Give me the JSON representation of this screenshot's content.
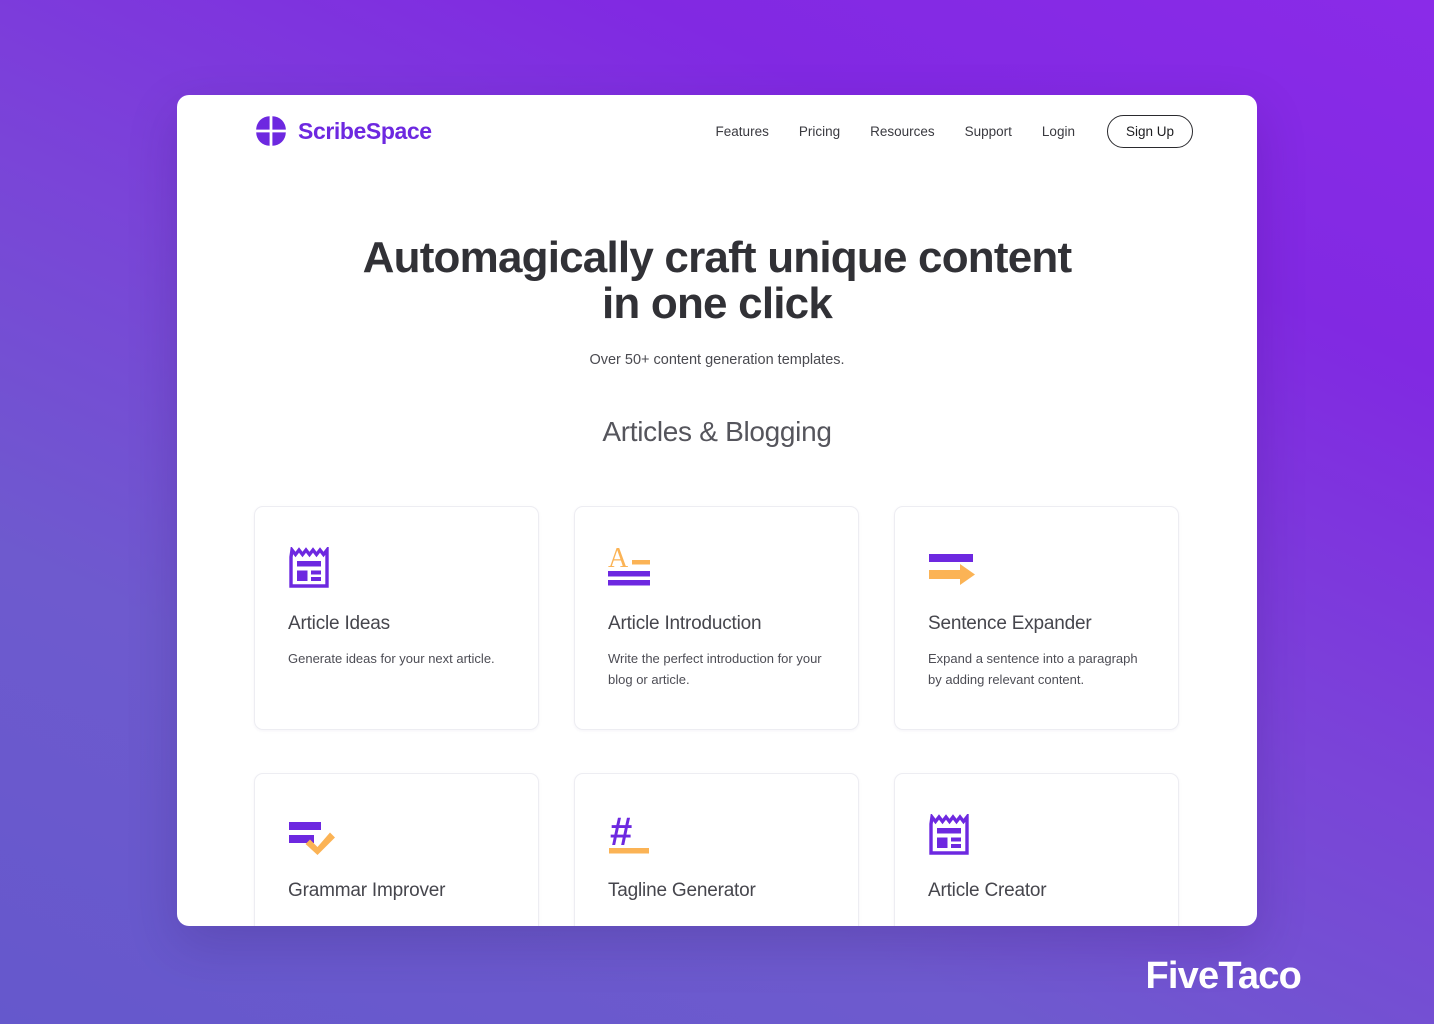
{
  "colors": {
    "brand_purple": "#6d28e0",
    "icon_purple": "#6d28e0",
    "icon_orange": "#fbb355",
    "bg_gradient_from": "#8a2be8",
    "bg_gradient_to": "#6558cc",
    "card_border": "#ededf2"
  },
  "header": {
    "logo_icon": "scribespace-logo-icon",
    "brand_name": "ScribeSpace",
    "nav": [
      {
        "label": "Features"
      },
      {
        "label": "Pricing"
      },
      {
        "label": "Resources"
      },
      {
        "label": "Support"
      },
      {
        "label": "Login"
      }
    ],
    "signup_label": "Sign Up"
  },
  "hero": {
    "title_line1": "Automagically craft unique content",
    "title_line2": "in one click",
    "subtitle": "Over 50+ content generation templates."
  },
  "section": {
    "title": "Articles & Blogging"
  },
  "templates": [
    {
      "icon": "article-layout-icon",
      "title": "Article Ideas",
      "desc": "Generate ideas for your next article."
    },
    {
      "icon": "letter-a-lines-icon",
      "title": "Article Introduction",
      "desc": "Write the perfect introduction for your blog or article."
    },
    {
      "icon": "bar-arrow-right-icon",
      "title": "Sentence Expander",
      "desc": "Expand a sentence into a paragraph by adding relevant content."
    },
    {
      "icon": "lines-check-icon",
      "title": "Grammar Improver",
      "desc": ""
    },
    {
      "icon": "hashtag-icon",
      "title": "Tagline Generator",
      "desc": ""
    },
    {
      "icon": "article-layout-icon",
      "title": "Article Creator",
      "desc": ""
    }
  ],
  "watermark": {
    "label": "FiveTaco"
  }
}
